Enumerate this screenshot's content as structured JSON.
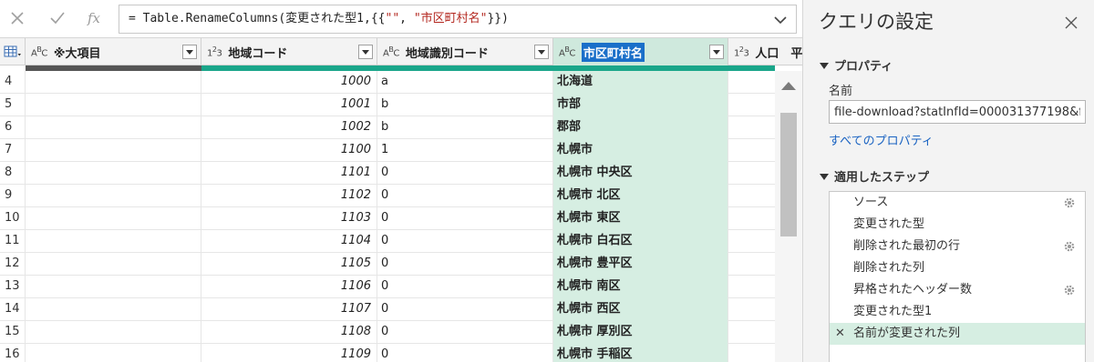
{
  "formula_bar": {
    "cancel_icon": "close-icon",
    "commit_icon": "checkmark-icon",
    "fx_label": "fx",
    "formula_prefix": "= Table.RenameColumns(変更された型1,{{",
    "formula_string1": "\"\"",
    "formula_sep": ", ",
    "formula_string2": "\"市区町村名\"",
    "formula_suffix": "}})"
  },
  "columns": [
    {
      "type_label": "ABC",
      "name": "※大項目"
    },
    {
      "type_label": "123",
      "name": "地域コード"
    },
    {
      "type_label": "ABC",
      "name": "地域識別コード"
    },
    {
      "type_label": "ABC",
      "name": "市区町村名"
    },
    {
      "type_label": "123",
      "name": "人口　平"
    }
  ],
  "rows": [
    {
      "n": "4",
      "daikomoku": "",
      "code": "1000",
      "shikibetsu": "a",
      "name": "北海道"
    },
    {
      "n": "5",
      "daikomoku": "",
      "code": "1001",
      "shikibetsu": "b",
      "name": "市部"
    },
    {
      "n": "6",
      "daikomoku": "",
      "code": "1002",
      "shikibetsu": "b",
      "name": "郡部"
    },
    {
      "n": "7",
      "daikomoku": "",
      "code": "1100",
      "shikibetsu": "1",
      "name": "札幌市"
    },
    {
      "n": "8",
      "daikomoku": "",
      "code": "1101",
      "shikibetsu": "0",
      "name": "札幌市 中央区"
    },
    {
      "n": "9",
      "daikomoku": "",
      "code": "1102",
      "shikibetsu": "0",
      "name": "札幌市 北区"
    },
    {
      "n": "10",
      "daikomoku": "",
      "code": "1103",
      "shikibetsu": "0",
      "name": "札幌市 東区"
    },
    {
      "n": "11",
      "daikomoku": "",
      "code": "1104",
      "shikibetsu": "0",
      "name": "札幌市 白石区"
    },
    {
      "n": "12",
      "daikomoku": "",
      "code": "1105",
      "shikibetsu": "0",
      "name": "札幌市 豊平区"
    },
    {
      "n": "13",
      "daikomoku": "",
      "code": "1106",
      "shikibetsu": "0",
      "name": "札幌市 南区"
    },
    {
      "n": "14",
      "daikomoku": "",
      "code": "1107",
      "shikibetsu": "0",
      "name": "札幌市 西区"
    },
    {
      "n": "15",
      "daikomoku": "",
      "code": "1108",
      "shikibetsu": "0",
      "name": "札幌市 厚別区"
    },
    {
      "n": "16",
      "daikomoku": "",
      "code": "1109",
      "shikibetsu": "0",
      "name": "札幌市 手稲区"
    }
  ],
  "settings": {
    "title": "クエリの設定",
    "properties_header": "プロパティ",
    "name_label": "名前",
    "name_value": "file-download?statInfId=000031377198&fi",
    "all_properties_link": "すべてのプロパティ",
    "steps_header": "適用したステップ",
    "steps": [
      {
        "label": "ソース",
        "gear": true,
        "active": false
      },
      {
        "label": "変更された型",
        "gear": false,
        "active": false
      },
      {
        "label": "削除された最初の行",
        "gear": true,
        "active": false
      },
      {
        "label": "削除された列",
        "gear": false,
        "active": false
      },
      {
        "label": "昇格されたヘッダー数",
        "gear": true,
        "active": false
      },
      {
        "label": "変更された型1",
        "gear": false,
        "active": false
      },
      {
        "label": "名前が変更された列",
        "gear": false,
        "active": true
      }
    ]
  },
  "colors": {
    "accent_teal": "#1aa68a",
    "selected_column_bg": "#d6eee2",
    "link": "#1a63c2",
    "quality_bar_dark": "#555555"
  }
}
